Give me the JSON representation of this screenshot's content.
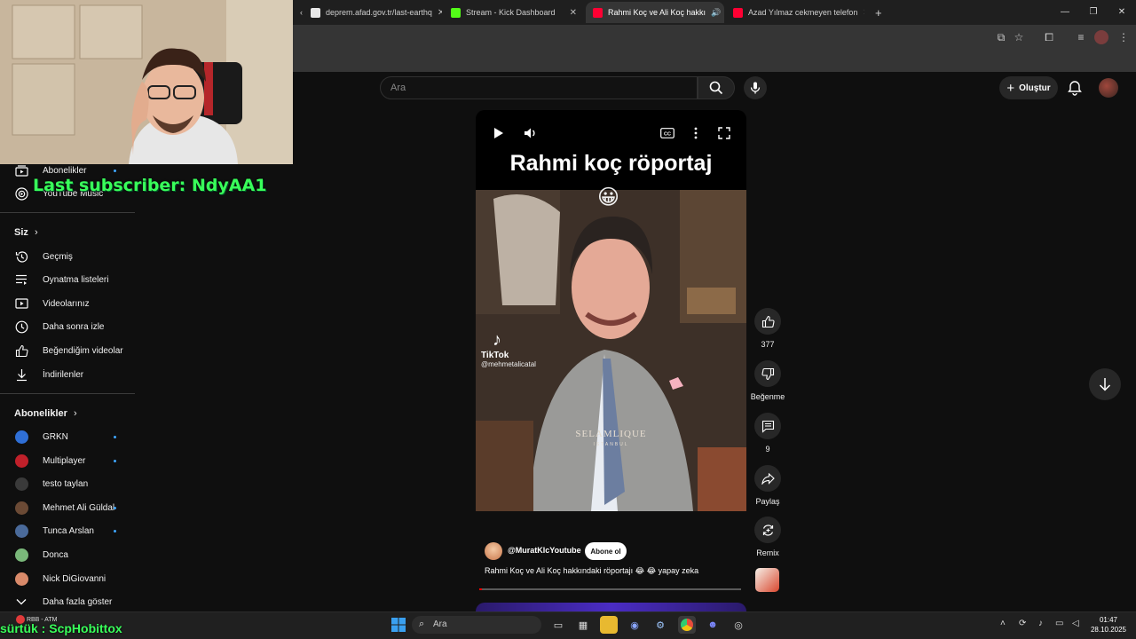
{
  "browser": {
    "tabs": [
      {
        "label": "deprem.afad.gov.tr/last-earthq",
        "active": false
      },
      {
        "label": "Stream - Kick Dashboard",
        "active": false
      },
      {
        "label": "Rahmi Koç ve Ali Koç hakkı",
        "active": true
      },
      {
        "label": "Azad Yılmaz cekmeyen telefon",
        "active": false
      }
    ],
    "new_tab": "+"
  },
  "youtube": {
    "search_placeholder": "Ara",
    "create_label": "Oluştur",
    "sidebar": {
      "top_items": [
        {
          "label": "Abonelikler",
          "icon": "subscriptions-icon",
          "dot": true
        },
        {
          "label": "YouTube Music",
          "icon": "music-icon",
          "dot": false
        }
      ],
      "you_header": "Siz",
      "you_items": [
        {
          "label": "Geçmiş",
          "icon": "history-icon"
        },
        {
          "label": "Oynatma listeleri",
          "icon": "playlist-icon"
        },
        {
          "label": "Videolarınız",
          "icon": "your-videos-icon"
        },
        {
          "label": "Daha sonra izle",
          "icon": "watch-later-icon"
        },
        {
          "label": "Beğendiğim videolar",
          "icon": "liked-icon"
        },
        {
          "label": "İndirilenler",
          "icon": "download-icon"
        }
      ],
      "subs_header": "Abonelikler",
      "channels": [
        {
          "label": "GRKN",
          "dot": true,
          "color": "#2f6fd6"
        },
        {
          "label": "Multiplayer",
          "dot": true,
          "color": "#c0202a"
        },
        {
          "label": "testo taylan",
          "dot": false,
          "color": "#3a3a3a"
        },
        {
          "label": "Mehmet Ali Güldal",
          "dot": true,
          "color": "#6b4a35"
        },
        {
          "label": "Tunca Arslan",
          "dot": true,
          "color": "#4a6a9a"
        },
        {
          "label": "Donca",
          "dot": false,
          "color": "#7ab87a"
        },
        {
          "label": "Nick DiGiovanni",
          "dot": false,
          "color": "#d98a6a"
        }
      ],
      "show_more": "Daha fazla göster"
    },
    "short": {
      "title": "Rahmi koç röportaj",
      "emoji": "😀",
      "tiktok_label": "TikTok",
      "tiktok_handle": "@mehmetalicatal",
      "watermark": "SELAMLIQUE",
      "watermark_sub": "ISTANBUL",
      "channel": "@MuratKlcYoutube",
      "subscribe_label": "Abone ol",
      "description": "Rahmi Koç ve Ali Koç hakkındaki röportajı 😂 😂 yapay zeka",
      "progress": 0.01
    },
    "actions": {
      "like_count": "377",
      "dislike_label": "Beğenme",
      "comments_count": "9",
      "share_label": "Paylaş",
      "remix_label": "Remix"
    }
  },
  "overlay": {
    "last_subscriber": "Last subscriber: NdyAA1",
    "ticker": "sürtük : ScpHobittox"
  },
  "taskbar": {
    "search_placeholder": "Ara",
    "time": "01:47",
    "date": "28.10.2025",
    "weather_label": "RBB - ATM"
  }
}
